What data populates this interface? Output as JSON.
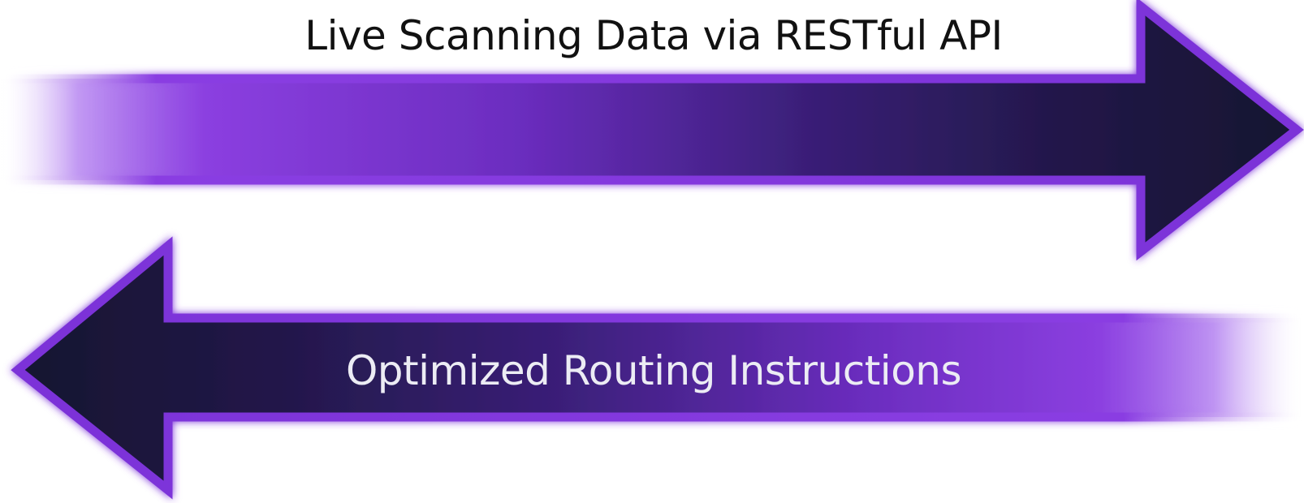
{
  "arrows": [
    {
      "id": "forward",
      "direction": "right",
      "label": "Live Scanning Data via RESTful API",
      "label_color": "#111111"
    },
    {
      "id": "return",
      "direction": "left",
      "label": "Optimized Routing Instructions",
      "label_color": "#ececf4"
    }
  ],
  "colors": {
    "background": "#ffffff",
    "arrow_light_purple": "#8b3fe0",
    "arrow_dark_navy": "#181335",
    "arrow_outline": "#7b32d8"
  }
}
